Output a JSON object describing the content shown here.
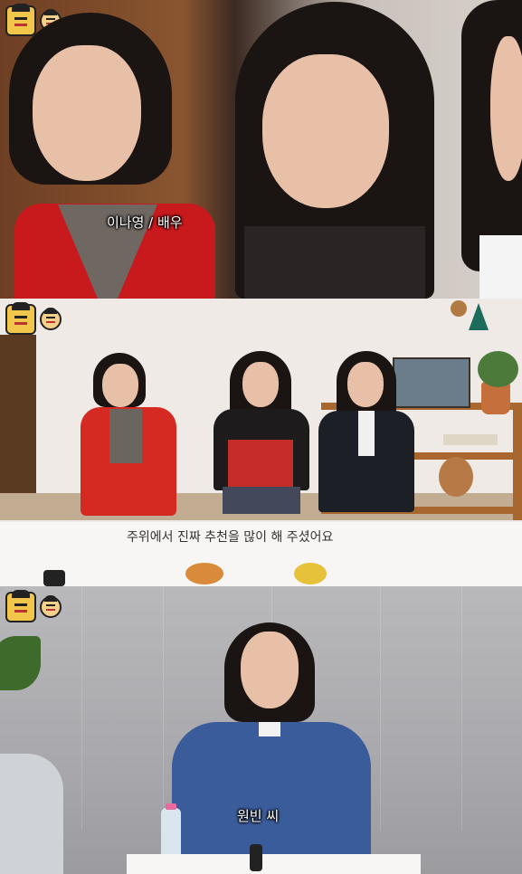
{
  "panels": [
    {
      "caption": "이나영 / 배우"
    },
    {
      "caption": "주위에서 진짜 추천을 많이 해 주셨어요"
    },
    {
      "caption": "원빈 씨"
    }
  ]
}
